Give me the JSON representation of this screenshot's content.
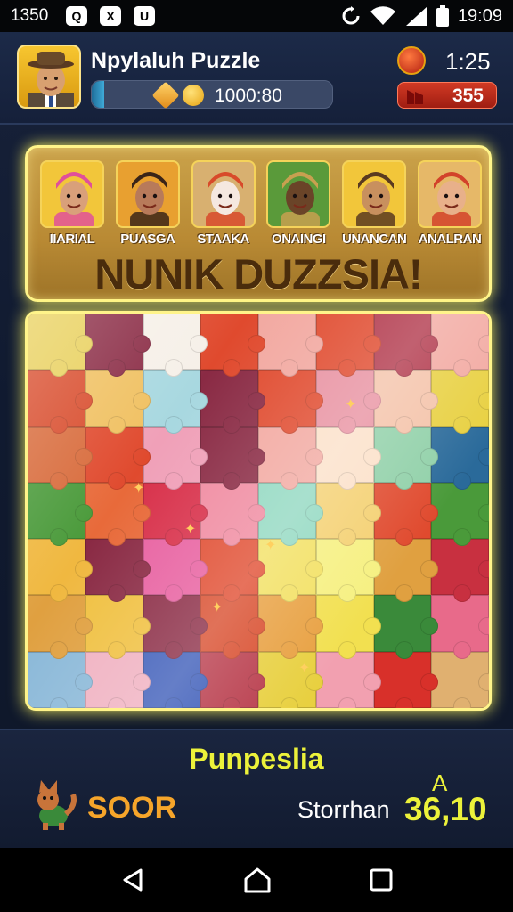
{
  "status_bar": {
    "left_time": "1350",
    "clock": "19:09",
    "app_icons": [
      "Q",
      "X",
      "U"
    ]
  },
  "header": {
    "title": "Npylaluh Puzzle",
    "progress_text": "1000:80",
    "progress_fraction": 0.05,
    "timer": "1:25",
    "score_badge": "355"
  },
  "banner": {
    "title": "NUNIK DUZZSIA!",
    "characters": [
      {
        "name": "IIARIAL",
        "skin": "#d9a07a",
        "bg": "#f2c63a",
        "hat": "#e0509a"
      },
      {
        "name": "PUASGA",
        "skin": "#b87a5a",
        "bg": "#e8a030",
        "hat": "#3a2418"
      },
      {
        "name": "STAAKA",
        "skin": "#f5e8e0",
        "bg": "#d8b070",
        "hat": "#d84a2a"
      },
      {
        "name": "ONAINGI",
        "skin": "#6a4428",
        "bg": "#5a9a3a",
        "hat": "#c8a050"
      },
      {
        "name": "UNANCAN",
        "skin": "#c8905e",
        "bg": "#f2c63a",
        "hat": "#5a3a20"
      },
      {
        "name": "ANALRAN",
        "skin": "#e8b08a",
        "bg": "#e6b868",
        "hat": "#d2422a"
      }
    ]
  },
  "board": {
    "colors": [
      "#e8cf58",
      "#8a2a44",
      "#f6f0e8",
      "#e04a2e",
      "#f2a8a0",
      "#e04a2e",
      "#b03448",
      "#f2a8a0",
      "#d84a2a",
      "#f0c060",
      "#a8d8e0",
      "#8a2a44",
      "#e04a2e",
      "#e890a0",
      "#f4c2a8",
      "#e8d040",
      "#d86a3a",
      "#e04a2e",
      "#f0a0b8",
      "#8a2a44",
      "#f2a8a0",
      "#fbe0c8",
      "#90d0a8",
      "#2a6a9a",
      "#4a9a3a",
      "#e86a3a",
      "#d8304a",
      "#f08aa0",
      "#90d8c0",
      "#f4d070",
      "#e04a2e",
      "#4a9a3a",
      "#f0b840",
      "#8a2a44",
      "#e860a0",
      "#e04a2e",
      "#f2e060",
      "#f6f080",
      "#e0a040",
      "#c83040",
      "#e0a040",
      "#f0c040",
      "#8a2a44",
      "#d84a2a",
      "#e8a040",
      "#f2e050",
      "#3a8a3a",
      "#e86a8a",
      "#8ab8d8",
      "#f0b0c0",
      "#3a5ab8",
      "#b83a4a",
      "#e8d040",
      "#f2a0b0",
      "#d8302a",
      "#e0b070"
    ]
  },
  "bottom": {
    "bonus_label": "Punpeslia",
    "player_label": "SOOR",
    "opponent_label": "Storrhan",
    "score_marker": "A",
    "score_value": "36,10"
  }
}
